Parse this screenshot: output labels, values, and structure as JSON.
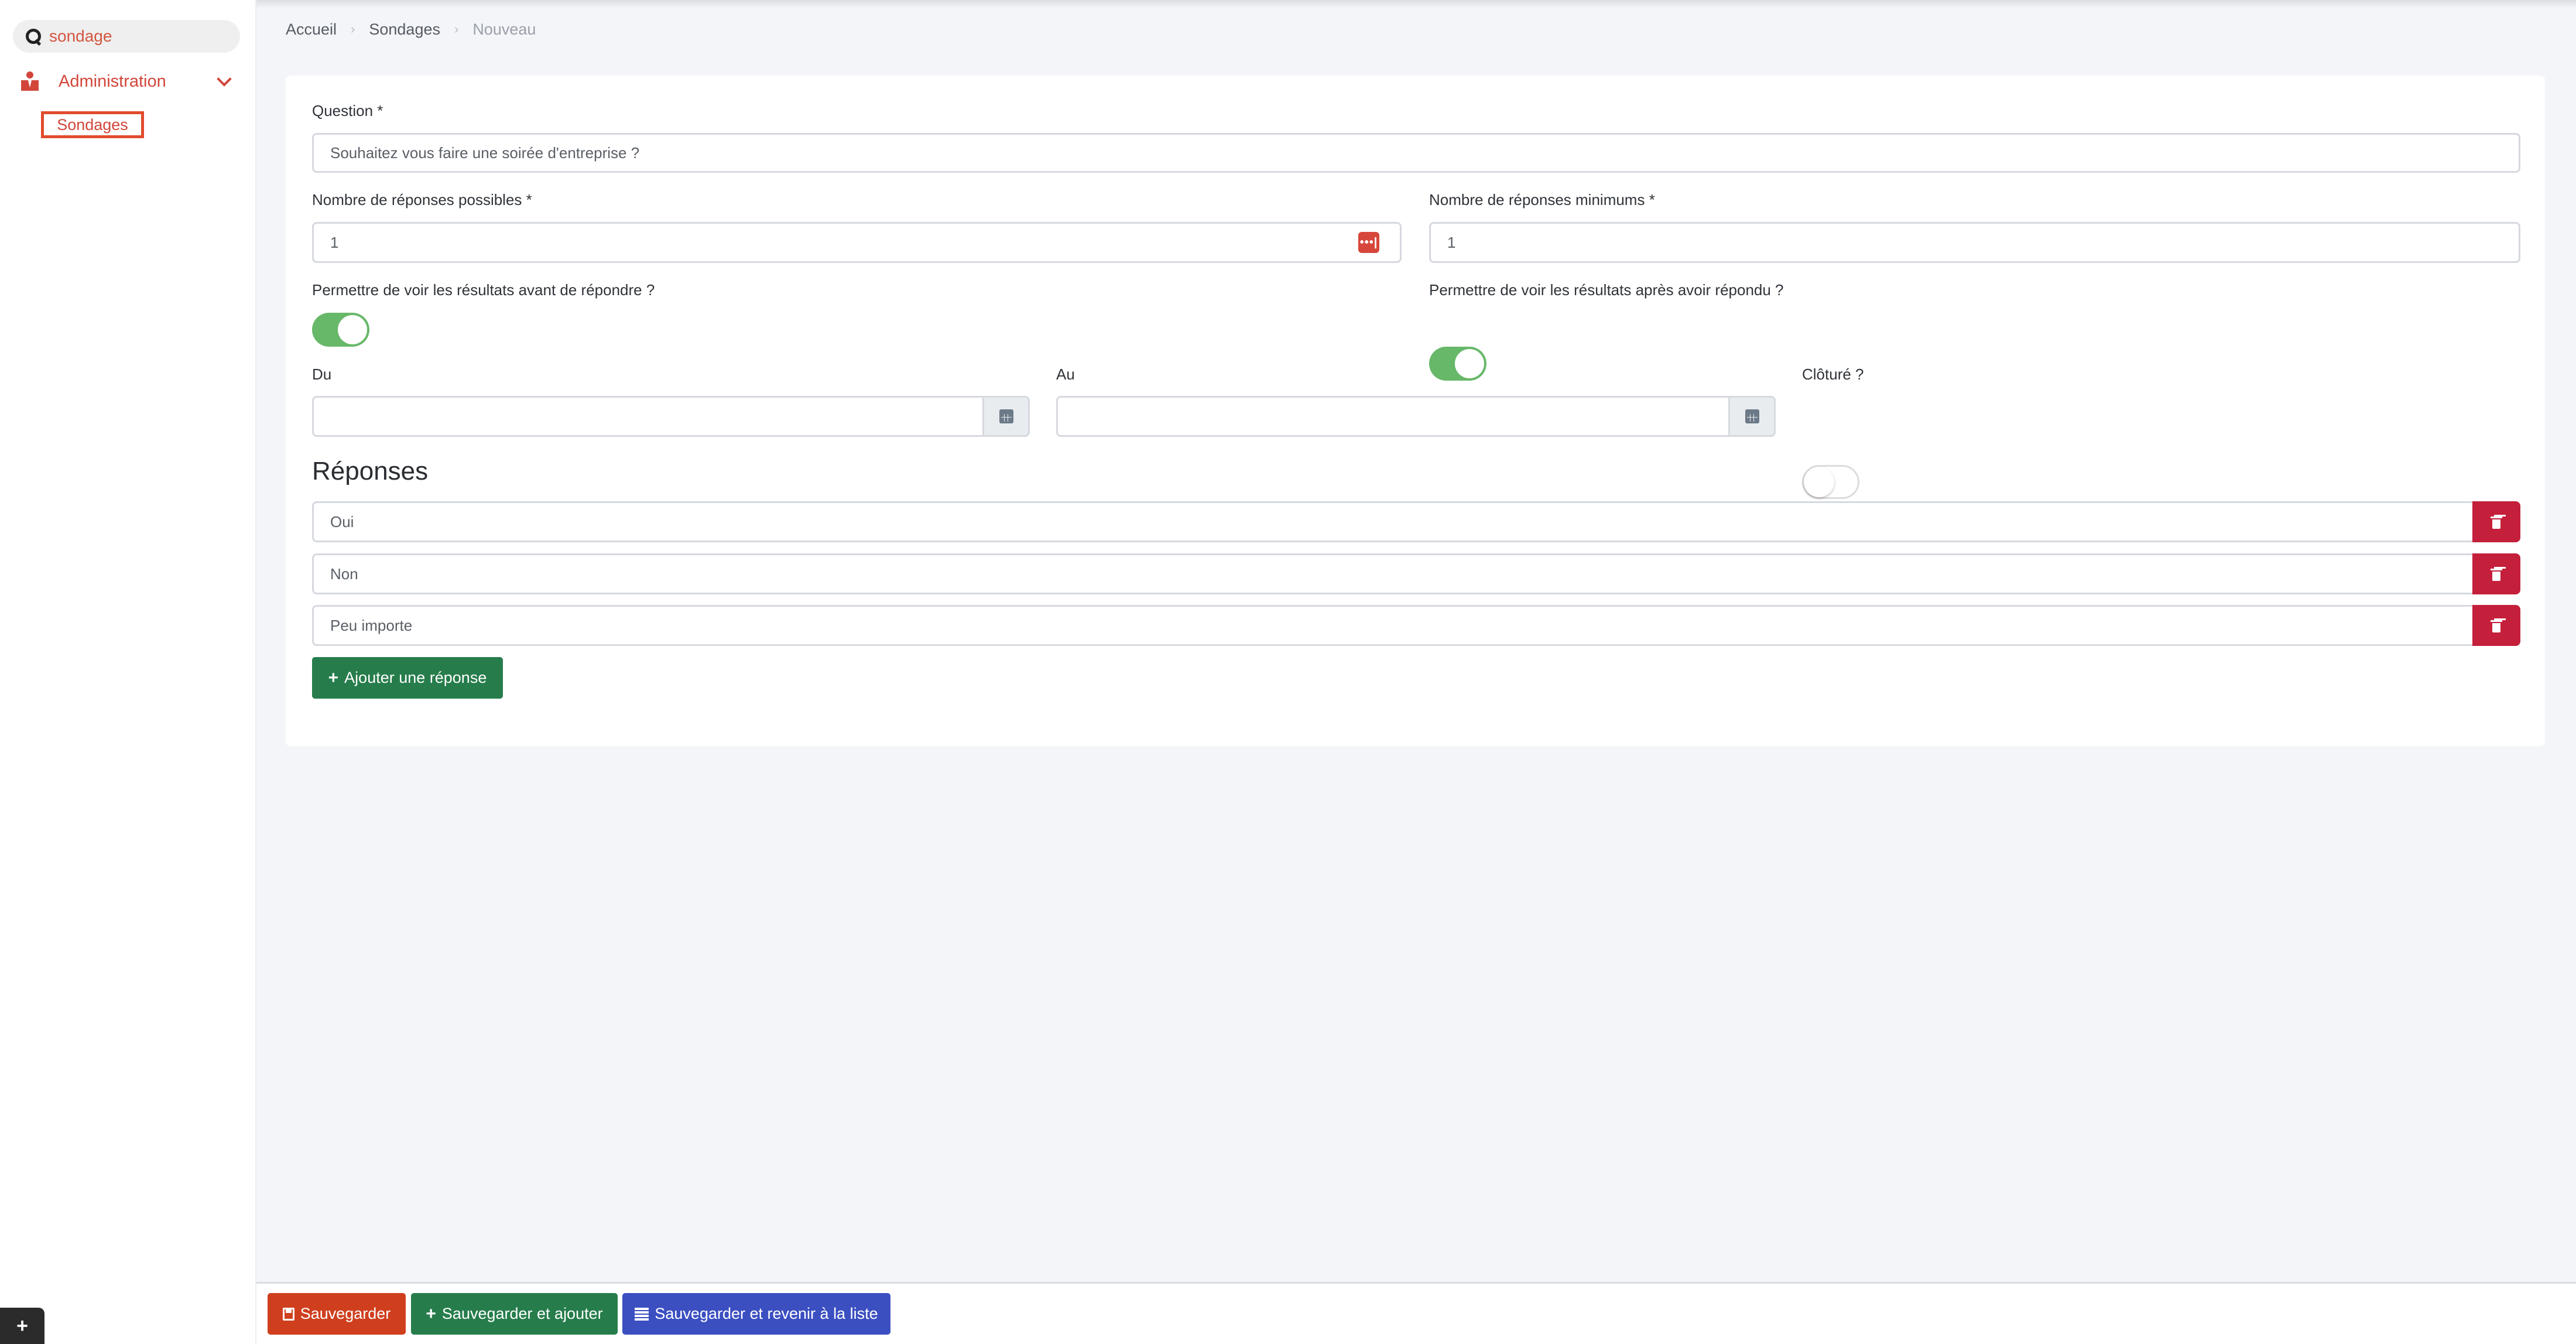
{
  "sidebar": {
    "search_value": "sondage",
    "menu": {
      "label": "Administration",
      "icon": "admin-user-icon",
      "expanded": true,
      "items": [
        {
          "label": "Sondages",
          "active": true
        }
      ]
    },
    "bottom_tab_label": "+"
  },
  "breadcrumb": [
    "Accueil",
    "Sondages",
    "Nouveau"
  ],
  "form": {
    "question": {
      "label": "Question *",
      "value": "Souhaitez vous faire une soirée d'entreprise ?"
    },
    "nb_possible": {
      "label": "Nombre de réponses possibles *",
      "value": "1",
      "extension_icon": "•••|"
    },
    "nb_minimum": {
      "label": "Nombre de réponses minimums *",
      "value": "1"
    },
    "see_before": {
      "label": "Permettre de voir les résultats avant de répondre ?",
      "checked": true
    },
    "see_after": {
      "label": "Permettre de voir les résultats après avoir répondu ?",
      "checked": true
    },
    "date_from": {
      "label": "Du",
      "value": ""
    },
    "date_to": {
      "label": "Au",
      "value": ""
    },
    "closed": {
      "label": "Clôturé ?",
      "checked": false
    }
  },
  "responses": {
    "title": "Réponses",
    "items": [
      "Oui",
      "Non",
      "Peu importe"
    ],
    "add_label": "Ajouter une réponse"
  },
  "footer": {
    "save_label": "Sauvegarder",
    "save_add_label": "Sauvegarder et ajouter",
    "save_list_label": "Sauvegarder et revenir à la liste"
  },
  "colors": {
    "accent": "#d2463a",
    "toggle_on": "#67b869",
    "danger": "#c41f3b",
    "success": "#267d4b",
    "save": "#cf3f1e",
    "primary": "#3b4fc1"
  }
}
